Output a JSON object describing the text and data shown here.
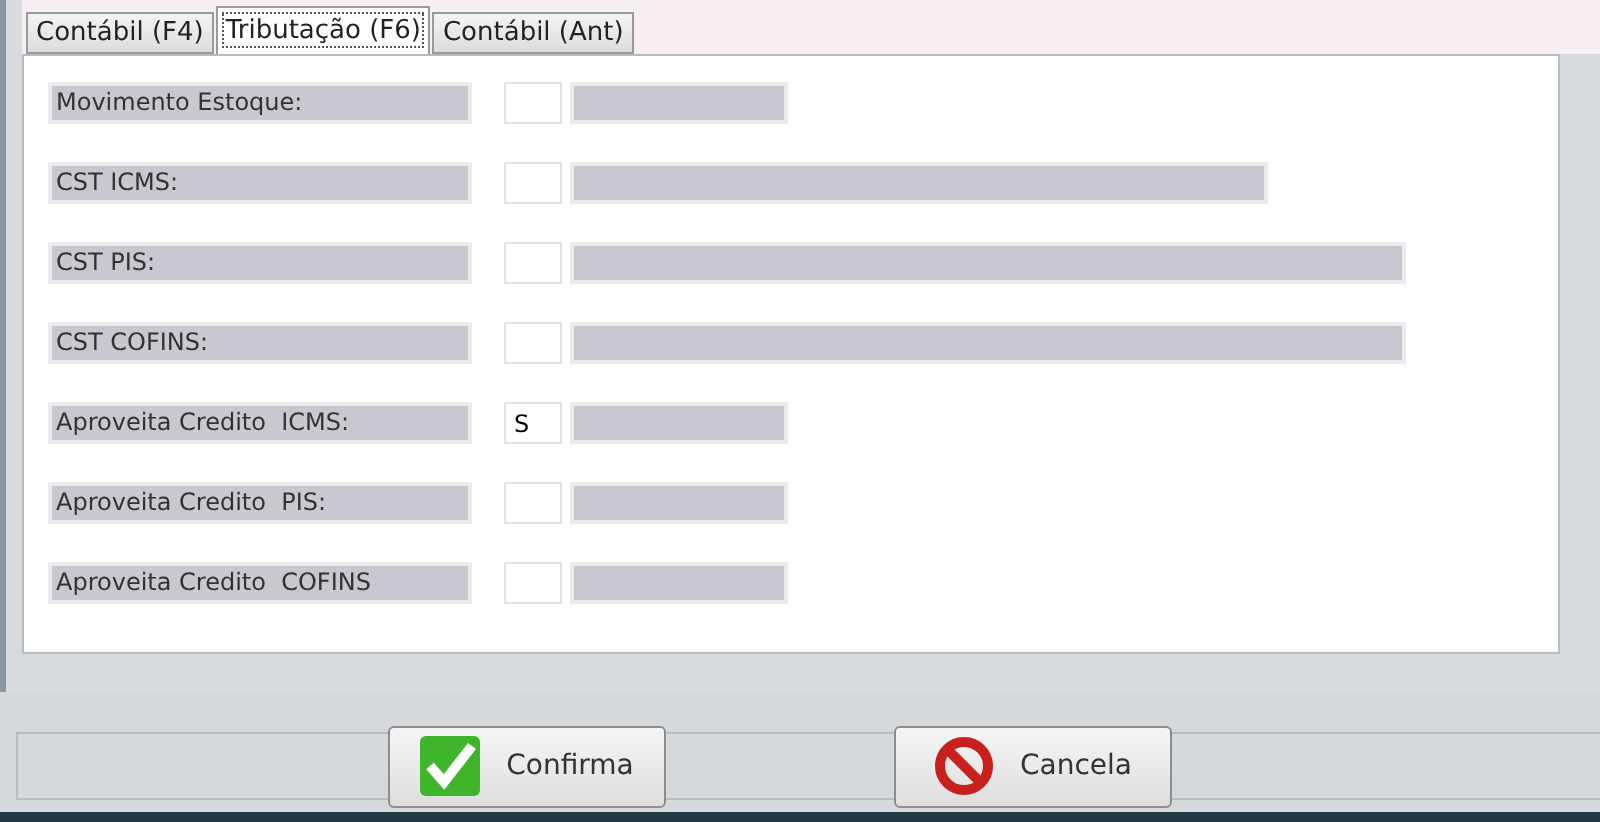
{
  "tabs": [
    {
      "label": "Contábil (F4)",
      "selected": false
    },
    {
      "label": "Tributação (F6)",
      "selected": true
    },
    {
      "label": "Contábil (Ant)",
      "selected": false
    }
  ],
  "fields": [
    {
      "label": "Movimento Estoque:",
      "kind": "short"
    },
    {
      "label": "CST ICMS:",
      "kind": "medium"
    },
    {
      "label": "CST PIS:",
      "kind": "long"
    },
    {
      "label": "CST COFINS:",
      "kind": "long"
    },
    {
      "label": "Aproveita Credito  ICMS:",
      "value": "S",
      "kind": "short"
    },
    {
      "label": "Aproveita Credito  PIS:",
      "kind": "short"
    },
    {
      "label": "Aproveita Credito  COFINS",
      "kind": "short"
    }
  ],
  "buttons": [
    {
      "label": "Confirma",
      "kind": "confirm"
    },
    {
      "label": "Cancela",
      "kind": "cancel"
    }
  ]
}
